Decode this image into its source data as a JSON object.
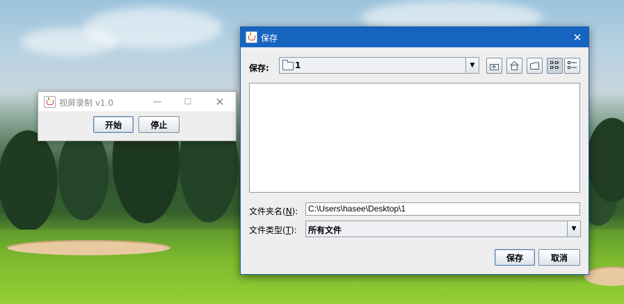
{
  "small_window": {
    "title": "视屏录制 v1.0",
    "start_label": "开始",
    "stop_label": "停止"
  },
  "save_dialog": {
    "title": "保存",
    "lookin_label": "保存:",
    "lookin_value": "1",
    "toolbar_icons": [
      "up-one-level-icon",
      "home-icon",
      "new-folder-icon",
      "list-view-icon",
      "details-view-icon"
    ],
    "filename_label_prefix": "文件夹名(",
    "filename_mnemonic": "N",
    "filename_label_suffix": "):",
    "filename_value": "C:\\Users\\hasee\\Desktop\\1",
    "filetype_label_prefix": "文件类型(",
    "filetype_mnemonic": "T",
    "filetype_label_suffix": "):",
    "filetype_value": "所有文件",
    "save_label": "保存",
    "cancel_label": "取消"
  },
  "colors": {
    "titlebar_accent": "#1565c0",
    "window_bg": "#eeeeee"
  }
}
